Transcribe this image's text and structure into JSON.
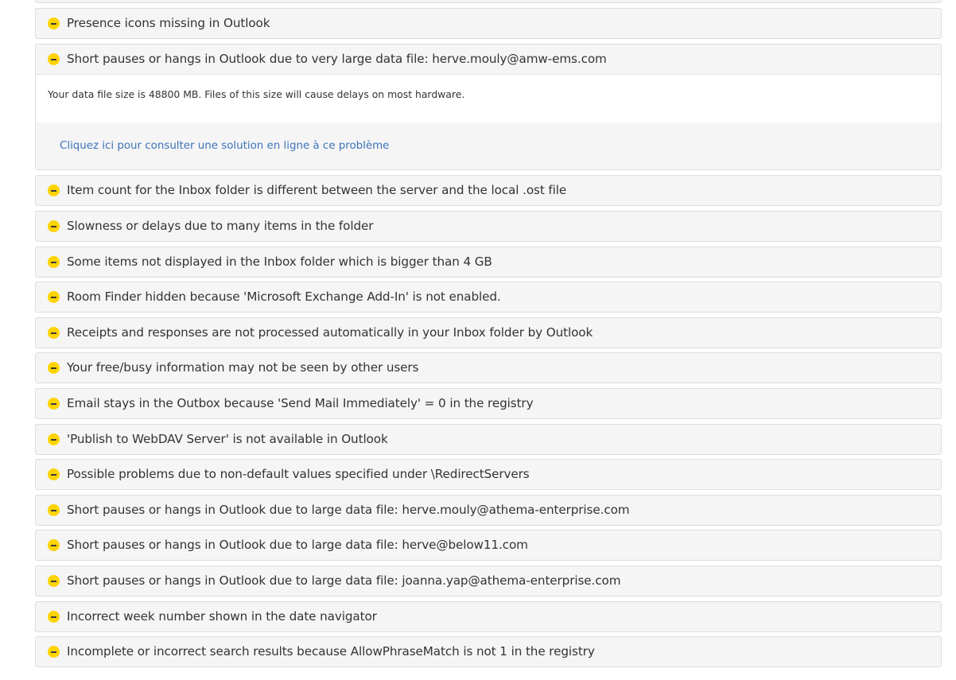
{
  "expanded_issue": {
    "title": "Short pauses or hangs in Outlook due to very large data file: herve.mouly@amw-ems.com",
    "description": "Your data file size is 48800 MB. Files of this size will cause delays on most hardware.",
    "solution_link": "Cliquez ici pour consulter une solution en ligne à ce problème"
  },
  "issues": [
    {
      "title": "Presence icons missing in Outlook"
    },
    {
      "title": "Item count for the Inbox folder is different between the server and the local .ost file"
    },
    {
      "title": "Slowness or delays due to many items in the folder"
    },
    {
      "title": "Some items not displayed in the Inbox folder which is bigger than 4 GB"
    },
    {
      "title": "Room Finder hidden because 'Microsoft Exchange Add-In' is not enabled."
    },
    {
      "title": "Receipts and responses are not processed automatically in your Inbox folder by Outlook"
    },
    {
      "title": "Your free/busy information may not be seen by other users"
    },
    {
      "title": "Email stays in the Outbox because 'Send Mail Immediately' = 0 in the registry"
    },
    {
      "title": "'Publish to WebDAV Server' is not available in Outlook"
    },
    {
      "title": "Possible problems due to non-default values specified under \\RedirectServers"
    },
    {
      "title": "Short pauses or hangs in Outlook due to large data file: herve.mouly@athema-enterprise.com"
    },
    {
      "title": "Short pauses or hangs in Outlook due to large data file: herve@below11.com"
    },
    {
      "title": "Short pauses or hangs in Outlook due to large data file: joanna.yap@athema-enterprise.com"
    },
    {
      "title": "Incorrect week number shown in the date navigator"
    },
    {
      "title": "Incomplete or incorrect search results because AllowPhraseMatch is not 1 in the registry"
    }
  ],
  "colors": {
    "warning_icon": "#ffd400",
    "link": "#3b73b9",
    "panel_bg": "#f5f5f5",
    "panel_border": "#dddddd",
    "text": "#333333"
  },
  "icons": {
    "warning": "warning-minus-circle-icon"
  }
}
